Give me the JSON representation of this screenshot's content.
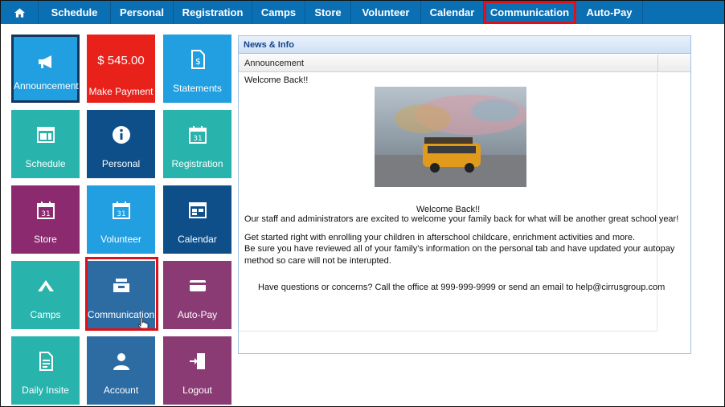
{
  "topnav": {
    "home_icon": "home-icon",
    "items": [
      {
        "label": "Schedule"
      },
      {
        "label": "Personal"
      },
      {
        "label": "Registration"
      },
      {
        "label": "Camps"
      },
      {
        "label": "Store"
      },
      {
        "label": "Volunteer"
      },
      {
        "label": "Calendar"
      },
      {
        "label": "Communication",
        "active": true
      },
      {
        "label": "Auto-Pay"
      }
    ]
  },
  "tiles": [
    {
      "label": "Announcement",
      "icon": "megaphone-icon",
      "color": "#219fe0"
    },
    {
      "label": "Make Payment",
      "amount": "$ 545.00",
      "color": "#e8211b"
    },
    {
      "label": "Statements",
      "icon": "document-dollar-icon",
      "color": "#219fe0"
    },
    {
      "label": "Schedule",
      "icon": "schedule-icon",
      "color": "#28b3ac"
    },
    {
      "label": "Personal",
      "icon": "info-icon",
      "color": "#0e4f8a"
    },
    {
      "label": "Registration",
      "icon": "calendar-31-icon",
      "color": "#28b3ac"
    },
    {
      "label": "Store",
      "icon": "calendar-31-icon",
      "color": "#8b2a6f"
    },
    {
      "label": "Volunteer",
      "icon": "calendar-31-icon",
      "color": "#219fe0"
    },
    {
      "label": "Calendar",
      "icon": "calendar-grid-icon",
      "color": "#0e4f8a"
    },
    {
      "label": "Camps",
      "icon": "tent-icon",
      "color": "#28b3ac"
    },
    {
      "label": "Communication",
      "icon": "inbox-icon",
      "color": "#2d6ba3"
    },
    {
      "label": "Auto-Pay",
      "icon": "credit-card-icon",
      "color": "#8a3b74"
    },
    {
      "label": "Daily Insite",
      "icon": "report-icon",
      "color": "#28b3ac"
    },
    {
      "label": "Account",
      "icon": "user-icon",
      "color": "#2d6ba3"
    },
    {
      "label": "Logout",
      "icon": "logout-door-icon",
      "color": "#8a3b74"
    }
  ],
  "news": {
    "title": "News & Info",
    "column_header": "Announcement",
    "greeting": "Welcome Back!!",
    "image_icon": "school-bus-photo",
    "centered_heading": "Welcome Back!!",
    "line1": "Our staff and administrators are excited to welcome your family back for what will be another great school year!",
    "line2": "Get started right with enrolling your children in afterschool childcare, enrichment activities and more.",
    "line3": "Be sure you have reviewed all of your family's  information on the personal tab and have updated your autopay",
    "line4": "method so care will not be interupted.",
    "line5": "Have questions or concerns?  Call the office at 999-999-9999 or send an email to help@cirrusgroup.com"
  }
}
